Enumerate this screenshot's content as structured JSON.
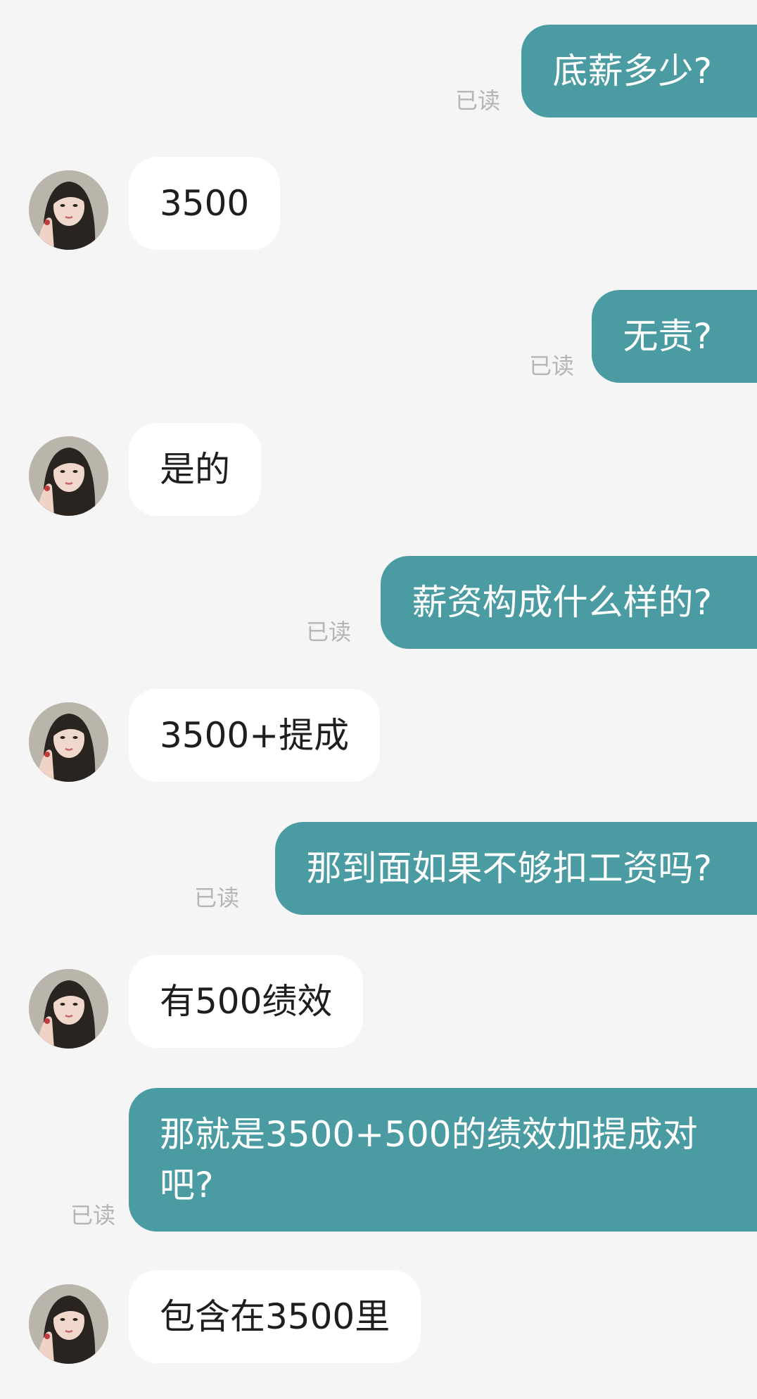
{
  "messages": {
    "m1": {
      "text": "底薪多少?",
      "read": "已读"
    },
    "m2": {
      "text": "3500"
    },
    "m3": {
      "text": "无责?",
      "read": "已读"
    },
    "m4": {
      "text": "是的"
    },
    "m5": {
      "text": "薪资构成什么样的?",
      "read": "已读"
    },
    "m6": {
      "text": "3500+提成"
    },
    "m7": {
      "text": "那到面如果不够扣工资吗?",
      "read": "已读"
    },
    "m8": {
      "text": "有500绩效"
    },
    "m9": {
      "text": "那就是3500+500的绩效加提成对吧?",
      "read": "已读"
    },
    "m10": {
      "text": "包含在3500里"
    }
  },
  "colors": {
    "background": "#f5f5f5",
    "outgoing_bubble": "#4b9ca2",
    "incoming_bubble": "#ffffff",
    "read_label": "#b5b5b5"
  },
  "icons": {
    "avatar": "contact-avatar-photo"
  }
}
